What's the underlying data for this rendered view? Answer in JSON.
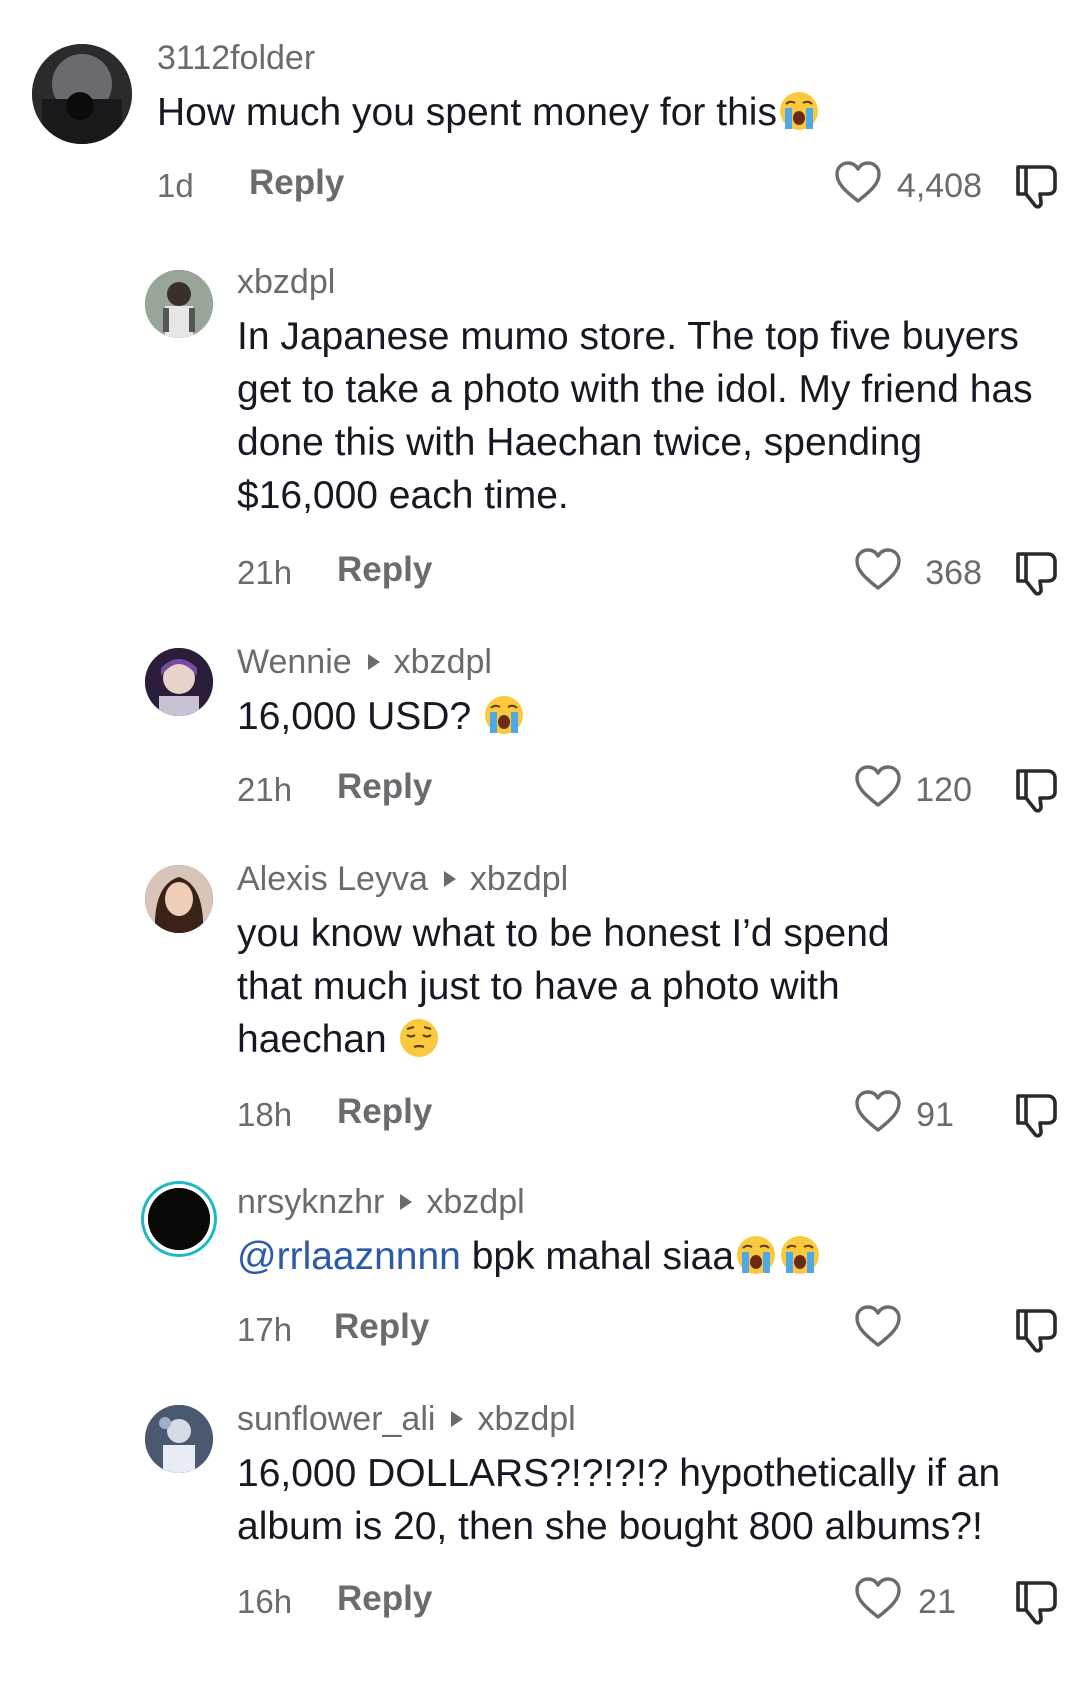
{
  "comments": [
    {
      "username": "3112folder",
      "reply_to": "",
      "text": "How much you spent money for this",
      "emoji": [
        "loudly-crying-face"
      ],
      "time": "1d",
      "reply_label": "Reply",
      "likes": "4,408"
    },
    {
      "username": "xbzdpl",
      "reply_to": "",
      "text": "In Japanese mumo store. The top five buyers get to take a photo with the idol. My friend has done this with Haechan twice, spending $16,000 each time.",
      "time": "21h",
      "reply_label": "Reply",
      "likes": "368"
    },
    {
      "username": "Wennie",
      "reply_to": "xbzdpl",
      "text": "16,000 USD?",
      "emoji": [
        "loudly-crying-face"
      ],
      "time": "21h",
      "reply_label": "Reply",
      "likes": "120"
    },
    {
      "username": "Alexis Leyva",
      "reply_to": "xbzdpl",
      "text": "you know what to be honest I’d spend that much just to have a photo with haechan",
      "emoji": [
        "pensive-face"
      ],
      "time": "18h",
      "reply_label": "Reply",
      "likes": "91"
    },
    {
      "username": "nrsyknzhr",
      "reply_to": "xbzdpl",
      "mention": "@rrlaaznnnn",
      "text": "bpk mahal siaa",
      "emoji": [
        "loudly-crying-face",
        "loudly-crying-face"
      ],
      "time": "17h",
      "reply_label": "Reply",
      "likes": ""
    },
    {
      "username": "sunflower_ali",
      "reply_to": "xbzdpl",
      "text": "16,000 DOLLARS?!?!?!? hypothetically if an album is 20, then she bought 800 albums?!",
      "time": "16h",
      "reply_label": "Reply",
      "likes": "21"
    }
  ],
  "colors": {
    "secondary_text": "#6b6b6f",
    "primary_text": "#161823",
    "mention": "#2b5aa7",
    "avatar_ring": "#1fb9c4"
  },
  "icons": {
    "like": "heart-outline-icon",
    "dislike": "thumbs-down-icon",
    "reply_arrow": "caret-right-icon"
  }
}
